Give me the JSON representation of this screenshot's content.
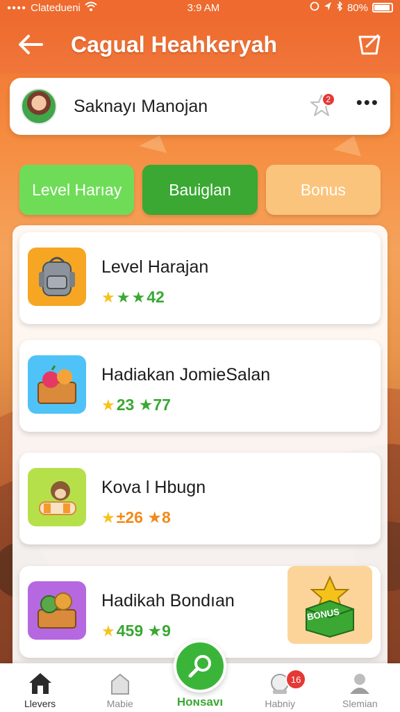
{
  "status_bar": {
    "carrier": "Clatedueni",
    "time": "3:9 AM",
    "battery": "80%"
  },
  "header": {
    "title": "Cagual Heahkeryah"
  },
  "profile": {
    "name": "Saknayı Manojan",
    "notification_count": "2"
  },
  "tabs": [
    {
      "label": "Level Harıay"
    },
    {
      "label": "Bauiglan"
    },
    {
      "label": "Bonus"
    }
  ],
  "items": [
    {
      "title": "Level Harajan",
      "score": "42",
      "icon": "backpack-icon"
    },
    {
      "title": "Hadiakan JomieSalan",
      "score": "23 ★77",
      "icon": "fruit-basket-icon"
    },
    {
      "title": "Kova l Hbugn",
      "score": "±26 ★8",
      "icon": "animal-toy-icon"
    },
    {
      "title": "Hadikah Bondıan",
      "score": "459 ★9",
      "icon": "treasure-chest-icon"
    }
  ],
  "bonus_box": {
    "label": "BONUS"
  },
  "bottom_nav": [
    {
      "label": "Llevers",
      "icon": "home-icon"
    },
    {
      "label": "Mabie",
      "icon": "house-icon"
    },
    {
      "label": "Hoɴsavı",
      "icon": "magnifier-icon"
    },
    {
      "label": "Habniy",
      "icon": "medal-icon",
      "badge": "16"
    },
    {
      "label": "Slemian",
      "icon": "profile-icon"
    }
  ],
  "colors": {
    "primary_orange": "#ee6a2e",
    "green": "#3aa833",
    "light_green": "#6fdc58",
    "bonus_orange": "#fbc47c"
  }
}
